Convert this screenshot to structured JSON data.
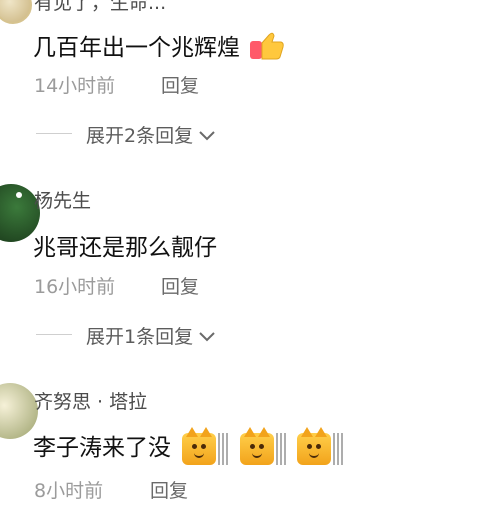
{
  "comments": [
    {
      "username_partial": "有见了，生命...",
      "text": "几百年出一个兆辉煌",
      "emoji": "thumbs-up-icon",
      "time": "14小时前",
      "reply_label": "回复",
      "expand_label": "展开2条回复"
    },
    {
      "username": "杨先生",
      "text": "兆哥还是那么靓仔",
      "time": "16小时前",
      "reply_label": "回复",
      "expand_label": "展开1条回复"
    },
    {
      "username": "齐努思 · 塔拉",
      "text": "李子涛来了没",
      "emoji": "cat-face-icon",
      "time": "8小时前",
      "reply_label": "回复"
    }
  ],
  "colors": {
    "username": "#4c4c4c",
    "comment": "#111111",
    "meta": "#9b9b9b",
    "accent": "#ffcf4a"
  }
}
